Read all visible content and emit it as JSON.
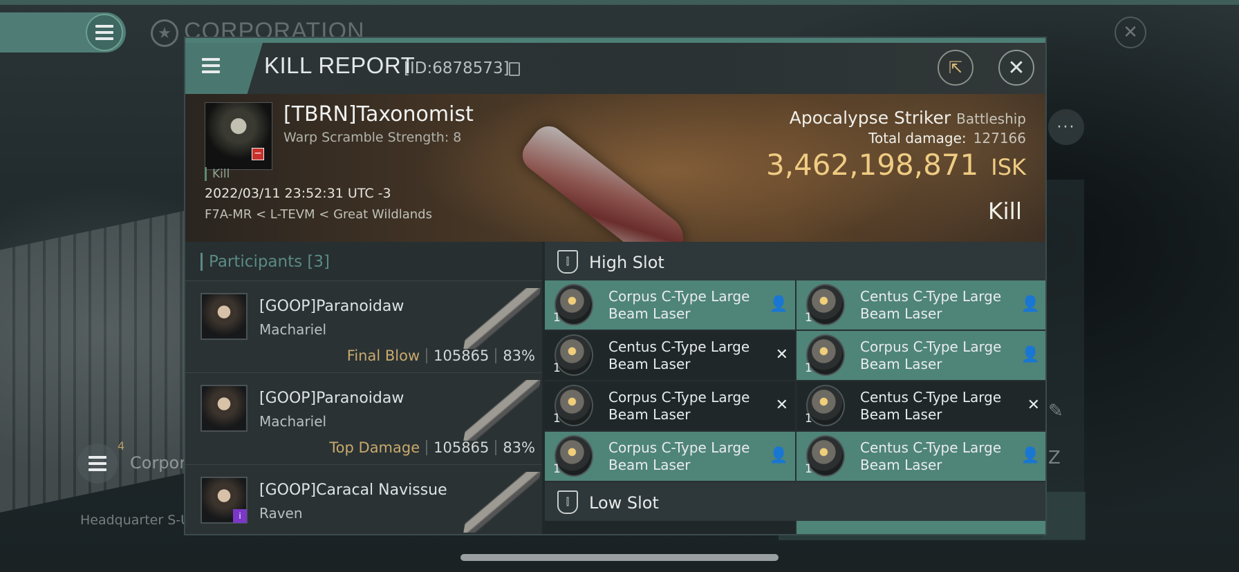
{
  "background": {
    "corp_title": "CORPORATION",
    "corp_label": "Corpora",
    "corp_count": "4",
    "hq_label": "Headquarter S-U",
    "more_label": "···"
  },
  "modal": {
    "title": "KILL REPORT",
    "id": "[ID:6878573]"
  },
  "victim": {
    "name": "[TBRN]Taxonomist",
    "warp": "Warp Scramble Strength: 8",
    "tag": "Kill",
    "datetime": "2022/03/11 23:52:31 UTC -3",
    "location": "F7A-MR < L-TEVM < Great Wildlands",
    "ship_name": "Apocalypse Striker",
    "ship_class": "Battleship",
    "damage_label": "Total damage:",
    "damage_value": "127166",
    "isk_value": "3,462,198,871",
    "isk_unit": "ISK",
    "result": "Kill"
  },
  "participants": {
    "label": "Participants",
    "count": "[3]",
    "rows": [
      {
        "name": "[GOOP]Paranoidaw",
        "ship": "Machariel",
        "label": "Final Blow",
        "damage": "105865",
        "pct": "83%"
      },
      {
        "name": "[GOOP]Paranoidaw",
        "ship": "Machariel",
        "label": "Top Damage",
        "damage": "105865",
        "pct": "83%"
      },
      {
        "name": "[GOOP]Caracal Navissue",
        "ship": "Raven",
        "label": "",
        "damage": "",
        "pct": ""
      }
    ]
  },
  "slots": {
    "high_title": "High Slot",
    "low_title": "Low Slot",
    "high": [
      {
        "name": "Corpus C-Type Large Beam Laser",
        "qty": "1",
        "status": "dropped"
      },
      {
        "name": "Centus C-Type Large Beam Laser",
        "qty": "1",
        "status": "dropped"
      },
      {
        "name": "Centus C-Type Large Beam Laser",
        "qty": "1",
        "status": "destroyed"
      },
      {
        "name": "Corpus C-Type Large Beam Laser",
        "qty": "1",
        "status": "dropped"
      },
      {
        "name": "Corpus C-Type Large Beam Laser",
        "qty": "1",
        "status": "destroyed"
      },
      {
        "name": "Centus C-Type Large Beam Laser",
        "qty": "1",
        "status": "destroyed"
      },
      {
        "name": "Corpus C-Type Large Beam Laser",
        "qty": "1",
        "status": "dropped"
      },
      {
        "name": "Centus C-Type Large Beam Laser",
        "qty": "1",
        "status": "dropped"
      }
    ]
  },
  "colors": {
    "accent": "#4f8479",
    "isk": "#efcc83",
    "label_gold": "#c9aa6c"
  }
}
